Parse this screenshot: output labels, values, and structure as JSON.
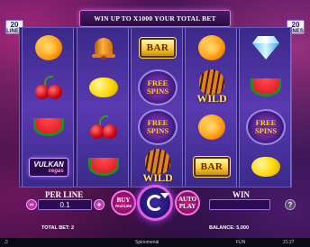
{
  "banner": {
    "text": "WIN UP TO X1000 YOUR TOTAL BET"
  },
  "lines_badge": {
    "count": "20",
    "label": "LINES"
  },
  "reels": [
    [
      "orange",
      "cherry",
      "melon",
      "vulkan"
    ],
    [
      "bell",
      "lemon",
      "cherry",
      "melon"
    ],
    [
      "bar",
      "free_spins",
      "free_spins",
      "wild"
    ],
    [
      "orange",
      "wild",
      "orange",
      "bar"
    ],
    [
      "diamond",
      "melon",
      "free_spins",
      "lemon"
    ]
  ],
  "symbols": {
    "bar_text": "BAR",
    "free_spins_line1": "FREE",
    "free_spins_line2": "SPINS",
    "wild_text": "WILD",
    "vulkan_text": "VULKAN",
    "vulkan_sub": "vegas"
  },
  "controls": {
    "per_line_label": "PER LINE",
    "per_line_value": "0.1",
    "minus": "−",
    "plus": "+",
    "buy_label": "BUY",
    "buy_sub": "FEATURE",
    "auto_label_1": "AUTO",
    "auto_label_2": "PLAY",
    "win_label": "WIN",
    "help": "?"
  },
  "info": {
    "total_bet": "TOTAL BET: 2",
    "balance": "BALANCE: 5,000"
  },
  "statusbar": {
    "brand": "Spinomenal",
    "mode": "FUN",
    "time": "21:27"
  },
  "colors": {
    "accent": "#e060e0",
    "gold": "#ffd040",
    "reel": "#3a2a8a"
  }
}
